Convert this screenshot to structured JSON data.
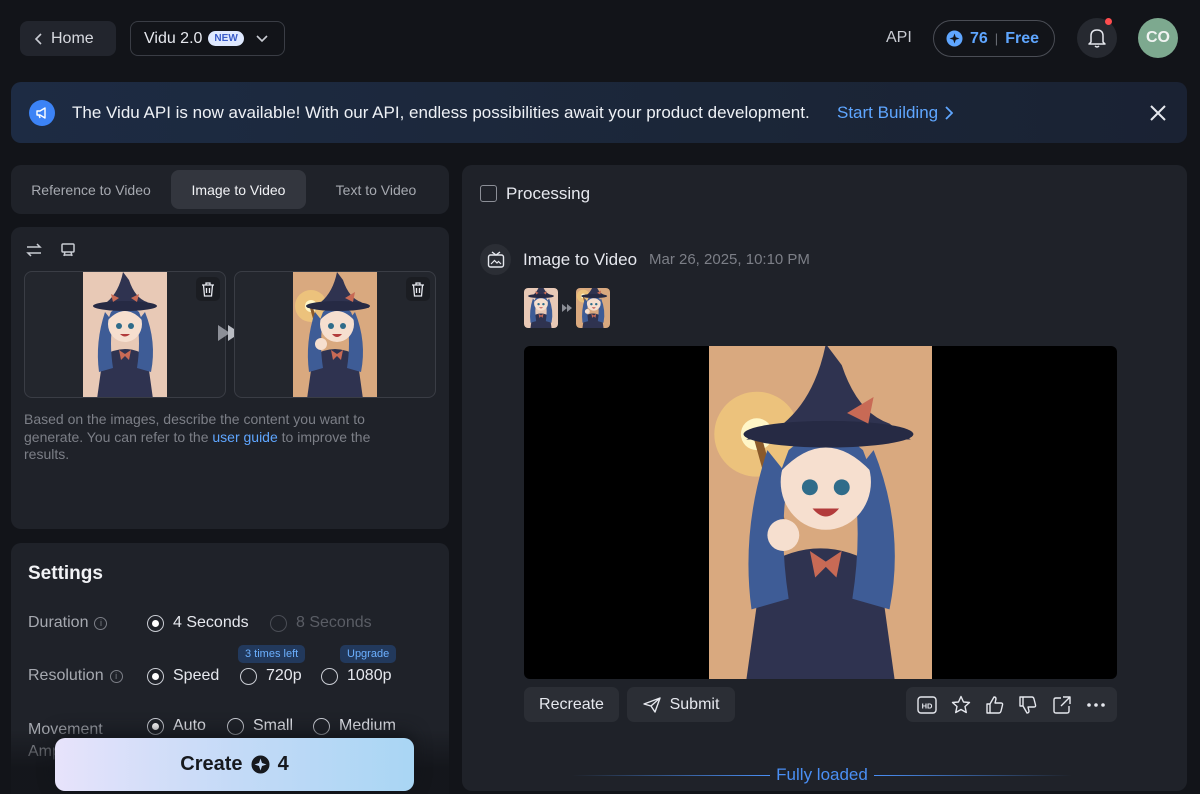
{
  "header": {
    "home_label": "Home",
    "model_label": "Vidu 2.0",
    "model_badge": "NEW",
    "api_label": "API",
    "credits_value": "76",
    "credits_separator": "|",
    "plan_label": "Free",
    "avatar_initials": "CO"
  },
  "banner": {
    "message": "The Vidu API is now available! With our API, endless possibilities await your product development.",
    "link_label": "Start Building"
  },
  "tabs": [
    {
      "label": "Reference to Video",
      "active": false
    },
    {
      "label": "Image to Video",
      "active": true
    },
    {
      "label": "Text to Video",
      "active": false
    }
  ],
  "prompt": {
    "placeholder_part1": "Based on the images, describe the content you want to generate. You can refer to the ",
    "placeholder_link": "user guide",
    "placeholder_part2": " to improve the results."
  },
  "settings": {
    "title": "Settings",
    "duration": {
      "label": "Duration",
      "options": [
        "4 Seconds",
        "8 Seconds"
      ],
      "selected": "4 Seconds",
      "disabled": [
        "8 Seconds"
      ]
    },
    "resolution": {
      "label": "Resolution",
      "options": [
        "Speed",
        "720p",
        "1080p"
      ],
      "selected": "Speed",
      "tags": {
        "720p": "3 times left",
        "1080p": "Upgrade"
      }
    },
    "movement": {
      "label": "Movement Amplitude",
      "options": [
        "Auto",
        "Small",
        "Medium"
      ],
      "selected": "Auto"
    }
  },
  "create": {
    "label": "Create",
    "cost": "4"
  },
  "result": {
    "status_label": "Processing",
    "task_title": "Image to Video",
    "task_date": "Mar 26, 2025, 10:10 PM",
    "recreate_label": "Recreate",
    "submit_label": "Submit",
    "hd_label": "HD",
    "footer_label": "Fully loaded"
  },
  "colors": {
    "accent_blue": "#5fa6ff",
    "background": "#121419",
    "panel": "#1f2229",
    "notification_dot": "#ff4d4f",
    "avatar_bg": "#7da98f"
  }
}
